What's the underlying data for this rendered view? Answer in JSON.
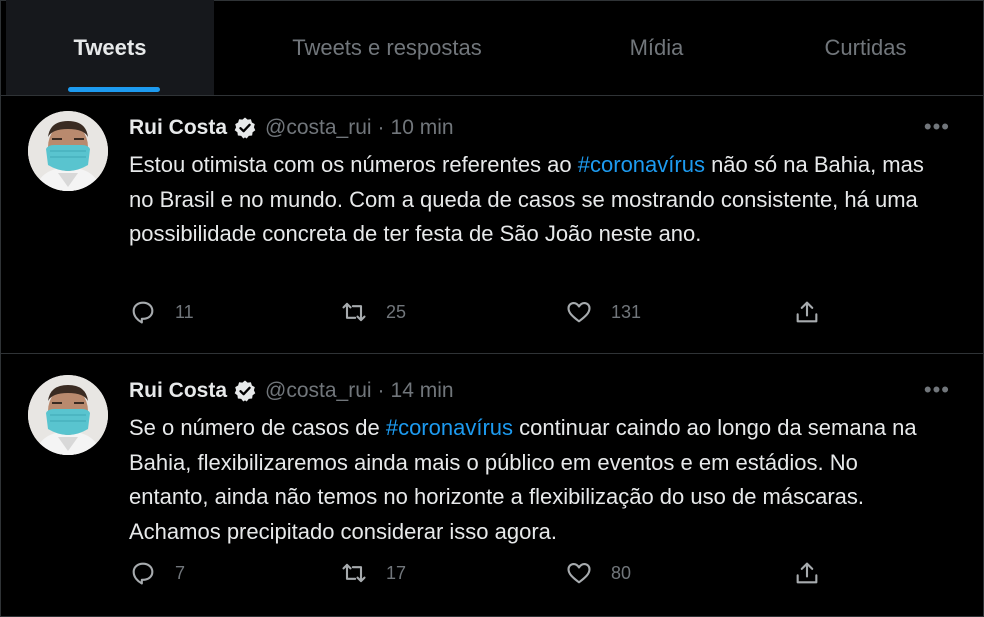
{
  "tabs": [
    {
      "label": "Tweets",
      "active": true
    },
    {
      "label": "Tweets e respostas",
      "active": false
    },
    {
      "label": "Mídia",
      "active": false
    },
    {
      "label": "Curtidas",
      "active": false
    }
  ],
  "accent_color": "#1d9bf0",
  "tweets": [
    {
      "author": "Rui Costa",
      "handle": "@costa_rui",
      "separator": "·",
      "time": "10 min",
      "text_before": "Estou otimista com os números referentes ao ",
      "hashtag": "#coronavírus",
      "text_after": " não só na Bahia, mas no Brasil e no mundo. Com a queda de casos se mostrando consistente, há uma possibilidade concreta de ter festa de São João neste ano.",
      "replies": "11",
      "retweets": "25",
      "likes": "131"
    },
    {
      "author": "Rui Costa",
      "handle": "@costa_rui",
      "separator": "·",
      "time": "14 min",
      "text_before": "Se o número de casos de ",
      "hashtag": "#coronavírus",
      "text_after": " continuar caindo ao longo da semana na Bahia, flexibilizaremos ainda mais o público em eventos e em estádios. No entanto, ainda não temos no horizonte a flexibilização do uso de máscaras. Achamos precipitado considerar isso agora.",
      "replies": "7",
      "retweets": "17",
      "likes": "80"
    }
  ],
  "icons": {
    "more": "more-dots-icon",
    "verified": "verified-badge-icon",
    "reply": "reply-icon",
    "retweet": "retweet-icon",
    "like": "heart-icon",
    "share": "share-icon"
  }
}
